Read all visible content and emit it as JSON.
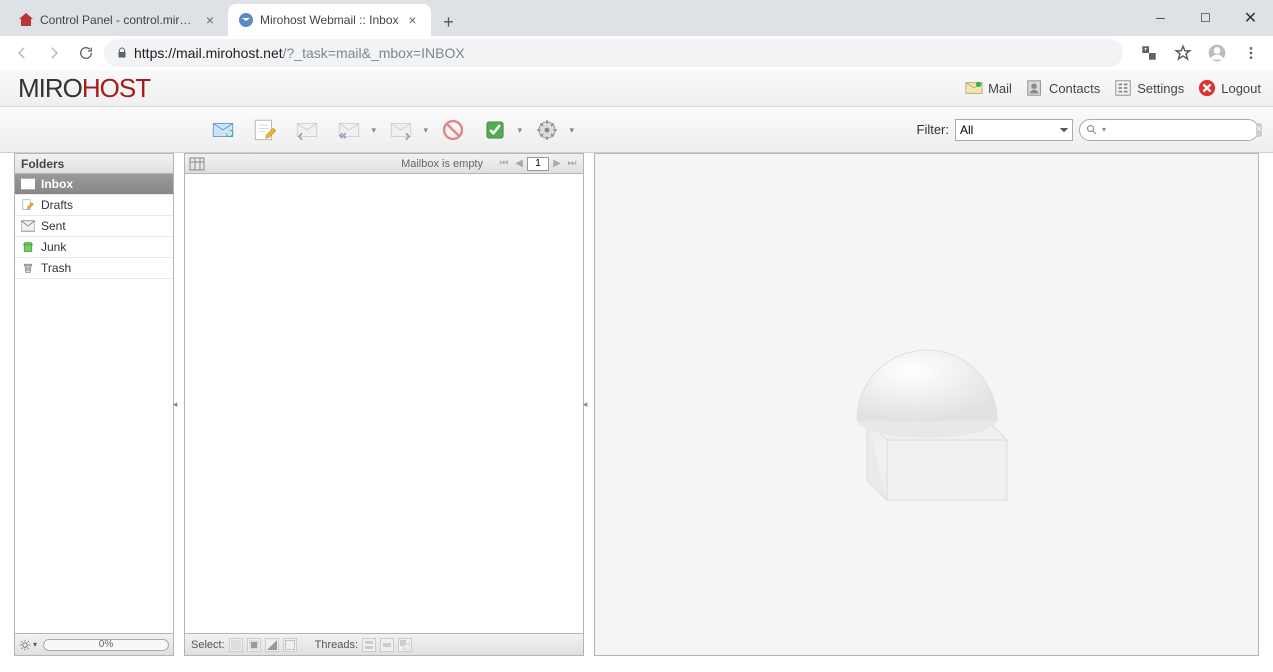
{
  "browser": {
    "tabs": [
      {
        "title": "Control Panel - control.mirohost...",
        "active": false
      },
      {
        "title": "Mirohost Webmail :: Inbox",
        "active": true
      }
    ],
    "url_display_host": "https://mail.mirohost.net",
    "url_display_path": "/?_task=mail&_mbox=INBOX"
  },
  "logo": {
    "part1": "MIRO",
    "part2": "HOST"
  },
  "header_nav": {
    "mail": "Mail",
    "contacts": "Contacts",
    "settings": "Settings",
    "logout": "Logout"
  },
  "toolbar": {
    "filter_label": "Filter:",
    "filter_value": "All",
    "search_placeholder": ""
  },
  "sidebar": {
    "title": "Folders",
    "folders": [
      {
        "name": "Inbox",
        "icon": "inbox",
        "selected": true
      },
      {
        "name": "Drafts",
        "icon": "drafts",
        "selected": false
      },
      {
        "name": "Sent",
        "icon": "sent",
        "selected": false
      },
      {
        "name": "Junk",
        "icon": "junk",
        "selected": false
      },
      {
        "name": "Trash",
        "icon": "trash",
        "selected": false
      }
    ],
    "quota": "0%"
  },
  "list": {
    "empty_text": "Mailbox is empty",
    "page": "1",
    "footer_select": "Select:",
    "footer_threads": "Threads:"
  }
}
